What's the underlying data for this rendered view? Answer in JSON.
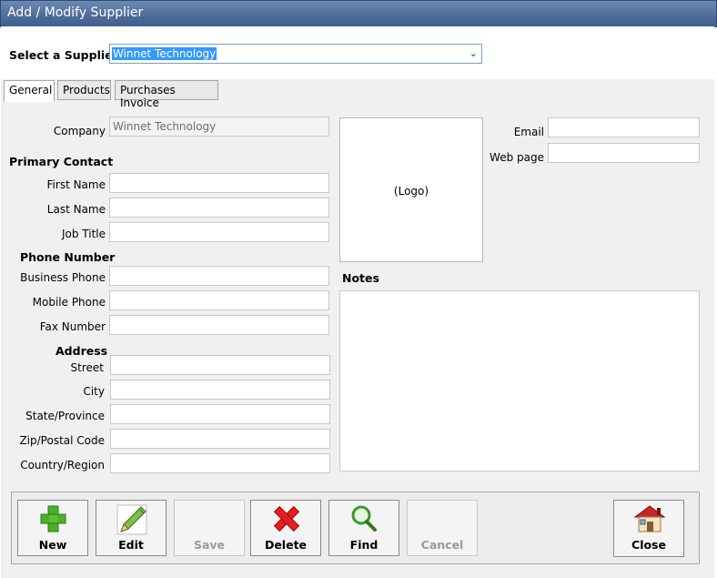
{
  "window": {
    "title": "Add / Modify Supplier"
  },
  "supplier_select": {
    "label": "Select a Supplier",
    "value": "Winnet Technology"
  },
  "tabs": [
    {
      "label": "General",
      "active": true
    },
    {
      "label": "Products",
      "active": false
    },
    {
      "label": "Purchases Invoice",
      "active": false
    }
  ],
  "form": {
    "company_label": "Company",
    "company_value": "Winnet Technology",
    "primary_contact_heading": "Primary Contact",
    "first_name_label": "First Name",
    "last_name_label": "Last Name",
    "job_title_label": "Job Title",
    "phone_heading": "Phone Number",
    "business_phone_label": "Business Phone",
    "mobile_phone_label": "Mobile Phone",
    "fax_label": "Fax Number",
    "address_heading": "Address",
    "street_label": "Street",
    "city_label": "City",
    "state_label": "State/Province",
    "zip_label": "Zip/Postal Code",
    "country_label": "Country/Region",
    "logo_placeholder": "(Logo)",
    "email_label": "Email",
    "webpage_label": "Web page",
    "notes_label": "Notes"
  },
  "buttons": {
    "new": "New",
    "edit": "Edit",
    "save": "Save",
    "delete": "Delete",
    "find": "Find",
    "cancel": "Cancel",
    "close": "Close"
  },
  "icons": [
    "plus-icon",
    "pencil-icon",
    "delete-x-icon",
    "magnifier-icon",
    "house-icon"
  ],
  "colors": {
    "titlebar": "#4e6c98",
    "selection": "#3399ff",
    "plus": "#4caf2a",
    "delete": "#e02020"
  }
}
